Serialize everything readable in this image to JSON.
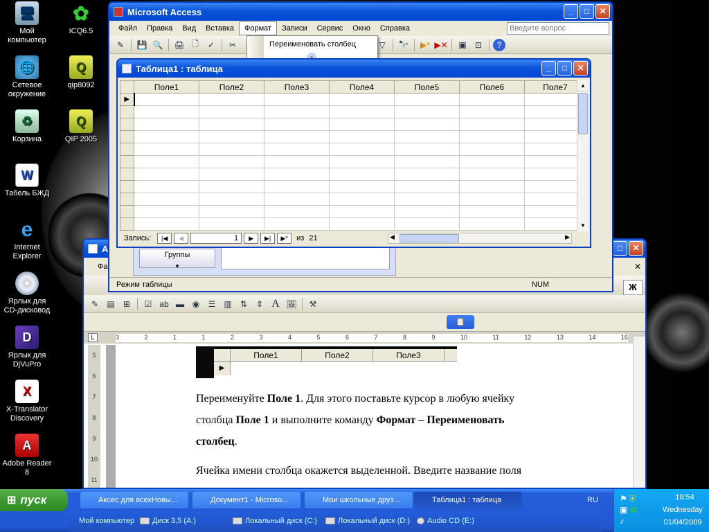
{
  "desktop": {
    "icons": [
      {
        "label_line1": "Мой",
        "label_line2": "компьютер"
      },
      {
        "label_line1": "Сетевое",
        "label_line2": "окружение"
      },
      {
        "label_line1": "Корзина",
        "label_line2": ""
      },
      {
        "label_line1": "Табель БЖД",
        "label_line2": ""
      },
      {
        "label_line1": "Internet",
        "label_line2": "Explorer"
      },
      {
        "label_line1": "Ярлык для",
        "label_line2": "CD-дисковод"
      },
      {
        "label_line1": "Ярлык для",
        "label_line2": "DjVuPro"
      },
      {
        "label_line1": "X-Translator",
        "label_line2": "Discovery"
      },
      {
        "label_line1": "Adobe Reader",
        "label_line2": "8"
      },
      {
        "label_line1": "ICQ6.5",
        "label_line2": ""
      },
      {
        "label_line1": "qip8092",
        "label_line2": ""
      },
      {
        "label_line1": "QIP 2005",
        "label_line2": ""
      }
    ]
  },
  "access": {
    "title": "Microsoft Access",
    "menu": [
      "Файл",
      "Правка",
      "Вид",
      "Вставка",
      "Формат",
      "Записи",
      "Сервис",
      "Окно",
      "Справка"
    ],
    "help_placeholder": "Введите вопрос",
    "format_menu": {
      "item": "Переименовать столбец"
    },
    "table_window": {
      "title": "Таблица1 : таблица",
      "columns": [
        "Поле1",
        "Поле2",
        "Поле3",
        "Поле4",
        "Поле5",
        "Поле6",
        "Поле7"
      ],
      "nav": {
        "label": "Запись:",
        "current": "1",
        "of": "из",
        "total": "21"
      }
    },
    "groups_label": "Группы",
    "status": {
      "mode": "Режим таблицы",
      "num": "NUM"
    }
  },
  "word": {
    "title_fragment": "Ак",
    "menu_fragment": "Фа",
    "mini_columns": [
      "Поле1",
      "Поле2",
      "Поле3"
    ],
    "bold_button": "Ж",
    "ruler_marks": [
      "3",
      "2",
      "1",
      "1",
      "2",
      "3",
      "4",
      "5",
      "6",
      "7",
      "8",
      "9",
      "10",
      "11",
      "12",
      "13",
      "14",
      "16"
    ],
    "vruler_marks": [
      "5",
      "6",
      "7",
      "8",
      "9",
      "10",
      "11"
    ],
    "paragraph1": {
      "line1_a": "Переименуйте ",
      "line1_b": "Поле 1",
      "line1_c": ". Для этого поставьте курсор в любую ячейку",
      "line2_a": "столбца ",
      "line2_b": "Поле 1",
      "line2_c": " и выполните команду ",
      "line2_d": "Формат – Переименовать",
      "line3_a": "столбец",
      "line3_b": "."
    },
    "paragraph2": "Ячейка имени столбца окажется выделенной. Введите название поля"
  },
  "taskbar": {
    "start": "пуск",
    "tasks": [
      "Аксес для всехНовы...",
      "Документ1 - Microso...",
      "Мои школьные друз...",
      "Таблица1 : таблица"
    ],
    "lang": "RU",
    "time": "19:54",
    "day": "Wednesday",
    "date": "01/04/2009",
    "quicklaunch": "Мой компьютер",
    "drives": [
      "Диск 3,5 (A:)",
      "Локальный диск (C:)",
      "Локальный диск (D:)",
      "Audio CD (E:)"
    ]
  }
}
